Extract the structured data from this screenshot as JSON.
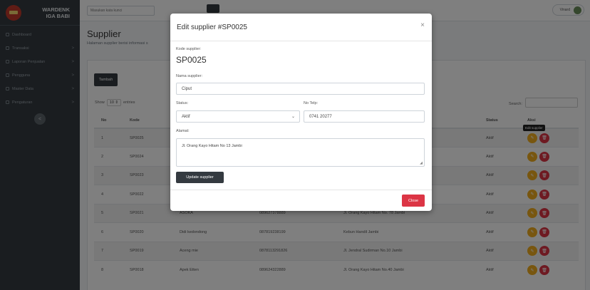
{
  "brand": {
    "line1": "WARDENK",
    "line2": "IGA BABI"
  },
  "sidebar": {
    "items": [
      {
        "label": "Dashboard",
        "chevron": ""
      },
      {
        "label": "Transaksi",
        "chevron": ">"
      },
      {
        "label": "Laporan Penjualan",
        "chevron": ">"
      },
      {
        "label": "Pengguna",
        "chevron": ">"
      },
      {
        "label": "Master Data",
        "chevron": ">"
      },
      {
        "label": "Pengaturan",
        "chevron": ">"
      }
    ],
    "toggle": "<"
  },
  "topbar": {
    "search_placeholder": "Masukan kata kunci",
    "user": "Vinard"
  },
  "page": {
    "title": "Supplier",
    "subtitle": "Halaman supplier berisi informasi s"
  },
  "toolbar": {
    "add_label": "Tambah"
  },
  "datatable": {
    "show": "Show",
    "entries_value": "10",
    "entries": "entries",
    "search_label": "Search:",
    "tooltip": "Edit supplier",
    "headers": {
      "no": "No",
      "kode": "Kode",
      "status": "Status",
      "aksi": "Aksi"
    },
    "rows": [
      {
        "no": "1",
        "kode": "SP0025",
        "nama": "",
        "telp": "",
        "alamat": "",
        "status": "Aktif"
      },
      {
        "no": "2",
        "kode": "SP0024",
        "nama": "",
        "telp": "",
        "alamat": "",
        "status": "Aktif"
      },
      {
        "no": "3",
        "kode": "SP0023",
        "nama": "",
        "telp": "",
        "alamat": "",
        "status": "Aktif"
      },
      {
        "no": "4",
        "kode": "SP0022",
        "nama": "",
        "telp": "",
        "alamat": "",
        "status": "Aktif"
      },
      {
        "no": "5",
        "kode": "SP0021",
        "nama": "ASOKA",
        "telp": "089627378889",
        "alamat": "Jl. Orang Kayo Hitam No. 78 Jambi",
        "status": "Aktif"
      },
      {
        "no": "6",
        "kode": "SP0020",
        "nama": "Didi kedondong",
        "telp": "087819238199",
        "alamat": "Kebun Handil Jambi",
        "status": "Aktif"
      },
      {
        "no": "7",
        "kode": "SP0019",
        "nama": "Aceng mie",
        "telp": "0878113291826",
        "alamat": "Jl. Jendral Sudirman No.10 Jambi",
        "status": "Aktif"
      },
      {
        "no": "8",
        "kode": "SP0018",
        "nama": "Apek Etten",
        "telp": "089624322889",
        "alamat": "Jl. Orang Kayo Hitam No.40 Jambi",
        "status": "Aktif"
      }
    ]
  },
  "modal": {
    "title": "Edit supplier #SP0025",
    "close_x": "×",
    "kode_label": "Kode supplier:",
    "kode_value": "SP0025",
    "nama_label": "Nama supplier:",
    "nama_value": "Ciput",
    "status_label": "Status:",
    "status_value": "Aktif",
    "telp_label": "No Telp:",
    "telp_value": "0741 20277",
    "alamat_label": "Alamat:",
    "alamat_value": "Jl. Orang Kayo Hitam No 13 Jambi",
    "update_label": "Update supplier",
    "close_label": "Close"
  },
  "icons": {
    "edit": "pencil-icon",
    "delete": "trash-icon",
    "chevron": "chevron-down-icon"
  },
  "colors": {
    "sidebar": "#343a40",
    "edit": "#f0ad1f",
    "delete": "#dc3545",
    "primary_dark": "#343a40"
  }
}
